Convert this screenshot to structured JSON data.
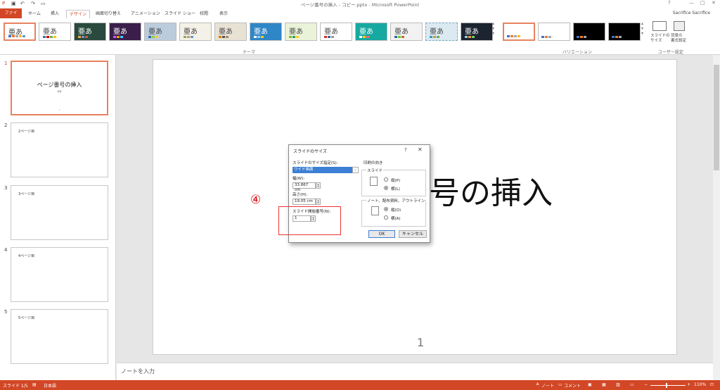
{
  "titlebar": {
    "title": "ページ番号の挿入 - コピー.pptx - Microsoft PowerPoint",
    "help": "?",
    "minimize": "—",
    "maximize": "□",
    "close": "✕"
  },
  "tabs": [
    "ファイル",
    "ホーム",
    "挿入",
    "デザイン",
    "画面切り替え",
    "アニメーション",
    "スライド ショー",
    "校閲",
    "表示"
  ],
  "user": "Sacrifice Sacrifice",
  "ribbon": {
    "theme_sample": "亜あ",
    "group_theme": "テーマ",
    "group_variation": "バリエーション",
    "group_user": "ユーザー設定",
    "slide_size": "スライドの\nサイズ",
    "bg_format": "背景の\n書式設定"
  },
  "slides": [
    {
      "num": "1",
      "title": "ページ番号の挿入",
      "sub": "学研",
      "page": "1"
    },
    {
      "num": "2",
      "title": "2ページ目"
    },
    {
      "num": "3",
      "title": "3ページ目"
    },
    {
      "num": "4",
      "title": "4ページ目"
    },
    {
      "num": "5",
      "title": "5ページ目"
    }
  ],
  "slide_main": {
    "title_visible": "号の挿入",
    "page_number": "1",
    "annotation": "④"
  },
  "notes_placeholder": "ノートを入力",
  "dialog": {
    "title": "スライドのサイズ",
    "help": "?",
    "close": "✕",
    "size_label": "スライドのサイズ指定(S):",
    "size_value": "ワイド画面",
    "width_label": "幅(W):",
    "width_value": "33.867 cm",
    "height_label": "高さ(H):",
    "height_value": "19.05 cm",
    "start_label": "スライド開始番号(N):",
    "start_value": "1",
    "orientation_label": "印刷の向き",
    "slide_group": "スライド",
    "portrait": "縦(P)",
    "landscape": "横(L)",
    "notes_group": "ノート、配布資料、アウトライン",
    "notes_portrait": "縦(O)",
    "notes_landscape": "横(A)",
    "ok": "OK",
    "cancel": "キャンセル"
  },
  "status": {
    "slide": "スライド 1/5",
    "lang": "日本語",
    "notes": "ノート",
    "comments": "コメント",
    "zoom": "110%"
  }
}
